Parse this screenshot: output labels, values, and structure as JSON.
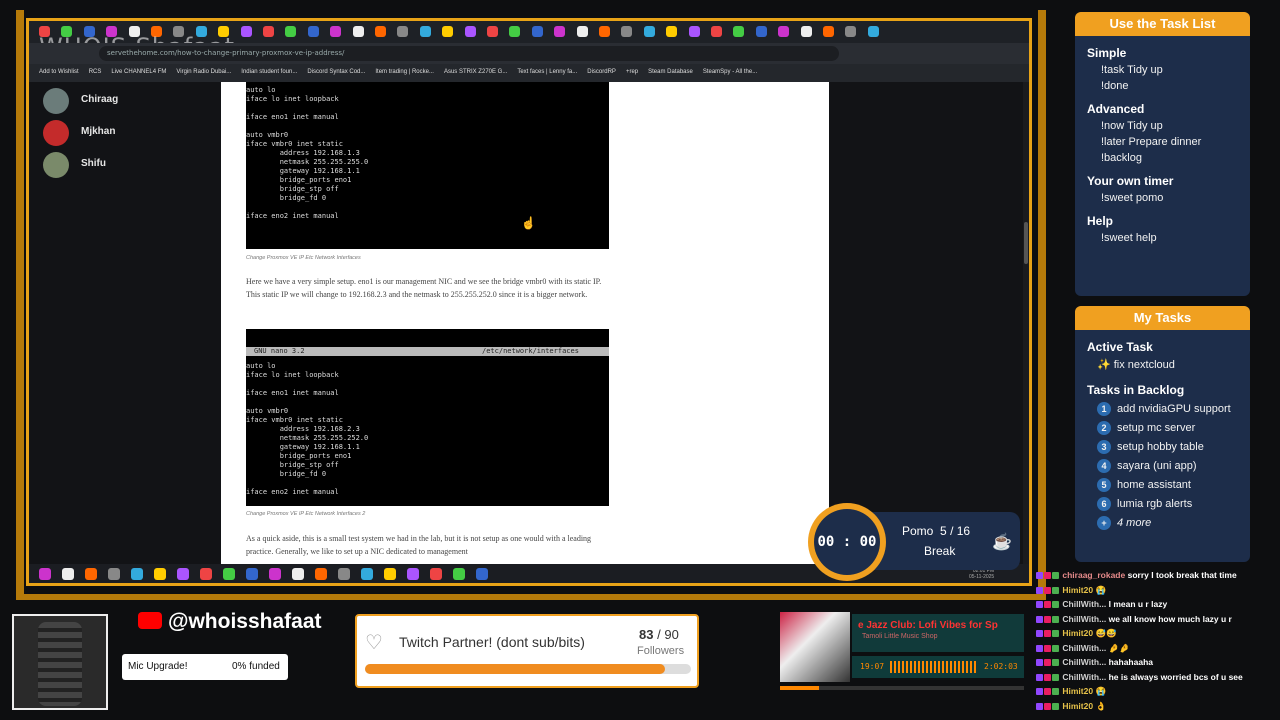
{
  "browser": {
    "url": "servethehome.com/how-to-change-primary-proxmox-ve-ip-address/",
    "bookmarks": [
      "Add to Wishlist",
      "RCS",
      "Live CHANNEL4 FM",
      "Virgin Radio Dubai...",
      "Indian student foun...",
      "Discord Syntax Cod...",
      "Item trading | Rocke...",
      "Asus STRIX Z270E G...",
      "Text faces | Lenny fa...",
      "DiscordRP",
      "+rep",
      "Steam Database",
      "SteamSpy - All the..."
    ]
  },
  "watermark": "WHOIS Shafaat",
  "discord_users": [
    {
      "name": "Chiraag",
      "color": "#6b7c7a"
    },
    {
      "name": "Mjkhan",
      "color": "#c42b2b"
    },
    {
      "name": "Shifu",
      "color": "#7a8a6a"
    }
  ],
  "article": {
    "term1": "auto lo\niface lo inet loopback\n\niface eno1 inet manual\n\nauto vmbr0\niface vmbr0 inet static\n        address 192.168.1.3\n        netmask 255.255.255.0\n        gateway 192.168.1.1\n        bridge_ports eno1\n        bridge_stp off\n        bridge_fd 0\n\niface eno2 inet manual",
    "caption1": "Change Proxmox VE IP Etc Network Interfaces",
    "para1": "Here we have a very simple setup. eno1 is our management NIC and we see the bridge vmbr0 with its static IP. This static IP we will change to 192.168.2.3 and the netmask to 255.255.252.0 since it is a bigger network.",
    "term2_header_left": "GNU nano 3.2",
    "term2_header_right": "/etc/network/interfaces",
    "term2": "auto lo\niface lo inet loopback\n\niface eno1 inet manual\n\nauto vmbr0\niface vmbr0 inet static\n        address 192.168.2.3\n        netmask 255.255.252.0\n        gateway 192.168.1.1\n        bridge_ports eno1\n        bridge_stp off\n        bridge_fd 0\n\niface eno2 inet manual",
    "caption2": "Change Proxmox VE IP Etc Network Interfaces 2",
    "para2": "As a quick aside, this is a small test system we had in the lab, but it is not setup as one would with a leading practice. Generally, we like to set up a NIC dedicated to management"
  },
  "taskbar_clock": {
    "time": "02:01 PM",
    "date": "05-11-2025"
  },
  "task_list": {
    "title": "Use the Task List",
    "sections": [
      {
        "heading": "Simple",
        "cmds": [
          "!task Tidy up",
          "!done"
        ]
      },
      {
        "heading": "Advanced",
        "cmds": [
          "!now Tidy up",
          "!later Prepare dinner",
          "!backlog"
        ]
      },
      {
        "heading": "Your own timer",
        "cmds": [
          "!sweet pomo"
        ]
      },
      {
        "heading": "Help",
        "cmds": [
          "!sweet help"
        ]
      }
    ]
  },
  "my_tasks": {
    "title": "My Tasks",
    "active_heading": "Active Task",
    "active": "✨ fix nextcloud",
    "backlog_heading": "Tasks in Backlog",
    "backlog": [
      "add nvidiaGPU support",
      "setup mc server",
      "setup hobby table",
      "sayara (uni app)",
      "home assistant",
      "lumia rgb alerts"
    ],
    "more": "4 more",
    "more_num": "+"
  },
  "pomo": {
    "time": "00 : 00",
    "label": "Pomo",
    "current": "5",
    "sep": "/",
    "total": "16",
    "state": "Break"
  },
  "social": {
    "handle": "@whoisshafaat"
  },
  "mic": {
    "label": "Mic Upgrade!",
    "funded": "0% funded",
    "progress": 0
  },
  "partner": {
    "title": "Twitch Partner! (dont sub/bits)",
    "current": "83",
    "sep": "/",
    "goal": "90",
    "unit": "Followers",
    "progress": 0.92
  },
  "music": {
    "title": "e Jazz Club: Lofi Vibes for Sp",
    "artist": "Tamoli Little Music Shop",
    "elapsed": "19:07",
    "total": "2:02:03",
    "progress": 0.16
  },
  "chat": [
    {
      "user": "chiraag_rokade",
      "msg": "sorry I took break that time",
      "color": "#e58a8a"
    },
    {
      "user": "Himit20",
      "msg": "😭",
      "color": "#e6c24a"
    },
    {
      "user": "ChillWith...",
      "msg": "I mean u r lazy",
      "color": "#cfcfcf"
    },
    {
      "user": "ChillWith...",
      "msg": "we all know how much lazy u r",
      "color": "#cfcfcf"
    },
    {
      "user": "Himit20",
      "msg": "😅😅",
      "color": "#e6c24a"
    },
    {
      "user": "ChillWith...",
      "msg": "🤌🤌",
      "color": "#cfcfcf"
    },
    {
      "user": "ChillWith...",
      "msg": "hahahaaha",
      "color": "#cfcfcf"
    },
    {
      "user": "ChillWith...",
      "msg": "he is always worried bcs of u see",
      "color": "#cfcfcf"
    },
    {
      "user": "Himit20",
      "msg": "😭",
      "color": "#e6c24a"
    },
    {
      "user": "Himit20",
      "msg": "👌",
      "color": "#e6c24a"
    }
  ]
}
